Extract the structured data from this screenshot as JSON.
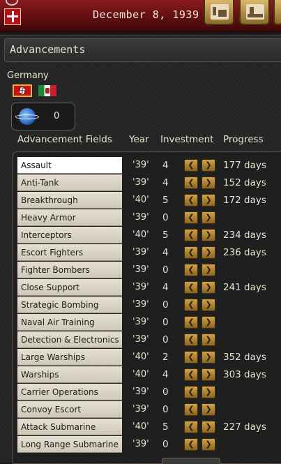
{
  "topbar": {
    "date": "December 8, 1939",
    "buttons": [
      {
        "icon": "factory-icon"
      },
      {
        "icon": "ship-icon"
      }
    ]
  },
  "panel": {
    "title": "Advancements",
    "country": "Germany",
    "flags": [
      "germany-flag-icon",
      "italy-flag-icon"
    ],
    "research_count": "0"
  },
  "columns": {
    "field": "Advancement Fields",
    "year": "Year",
    "investment": "Investment",
    "progress": "Progress"
  },
  "rows": [
    {
      "name": "Assault",
      "year": "'39'",
      "investment": "4",
      "progress": "177 days",
      "selected": true
    },
    {
      "name": "Anti-Tank",
      "year": "'39'",
      "investment": "4",
      "progress": "152 days"
    },
    {
      "name": "Breakthrough",
      "year": "'40'",
      "investment": "5",
      "progress": "172 days"
    },
    {
      "name": "Heavy Armor",
      "year": "'39'",
      "investment": "0",
      "progress": ""
    },
    {
      "name": "Interceptors",
      "year": "'40'",
      "investment": "5",
      "progress": "234 days"
    },
    {
      "name": "Escort Fighters",
      "year": "'39'",
      "investment": "4",
      "progress": "236 days"
    },
    {
      "name": "Fighter Bombers",
      "year": "'39'",
      "investment": "0",
      "progress": ""
    },
    {
      "name": "Close Support",
      "year": "'39'",
      "investment": "4",
      "progress": "241 days"
    },
    {
      "name": "Strategic Bombing",
      "year": "'39'",
      "investment": "0",
      "progress": ""
    },
    {
      "name": "Naval Air Training",
      "year": "'39'",
      "investment": "0",
      "progress": ""
    },
    {
      "name": "Detection & Electronics",
      "year": "'39'",
      "investment": "0",
      "progress": ""
    },
    {
      "name": "Large Warships",
      "year": "'40'",
      "investment": "2",
      "progress": "352 days"
    },
    {
      "name": "Warships",
      "year": "'40'",
      "investment": "4",
      "progress": "303 days"
    },
    {
      "name": "Carrier Operations",
      "year": "'39'",
      "investment": "0",
      "progress": ""
    },
    {
      "name": "Convoy Escort",
      "year": "'39'",
      "investment": "0",
      "progress": ""
    },
    {
      "name": "Attack Submarine",
      "year": "'40'",
      "investment": "5",
      "progress": "227 days"
    },
    {
      "name": "Long Range Submarine",
      "year": "'39'",
      "investment": "0",
      "progress": ""
    }
  ]
}
